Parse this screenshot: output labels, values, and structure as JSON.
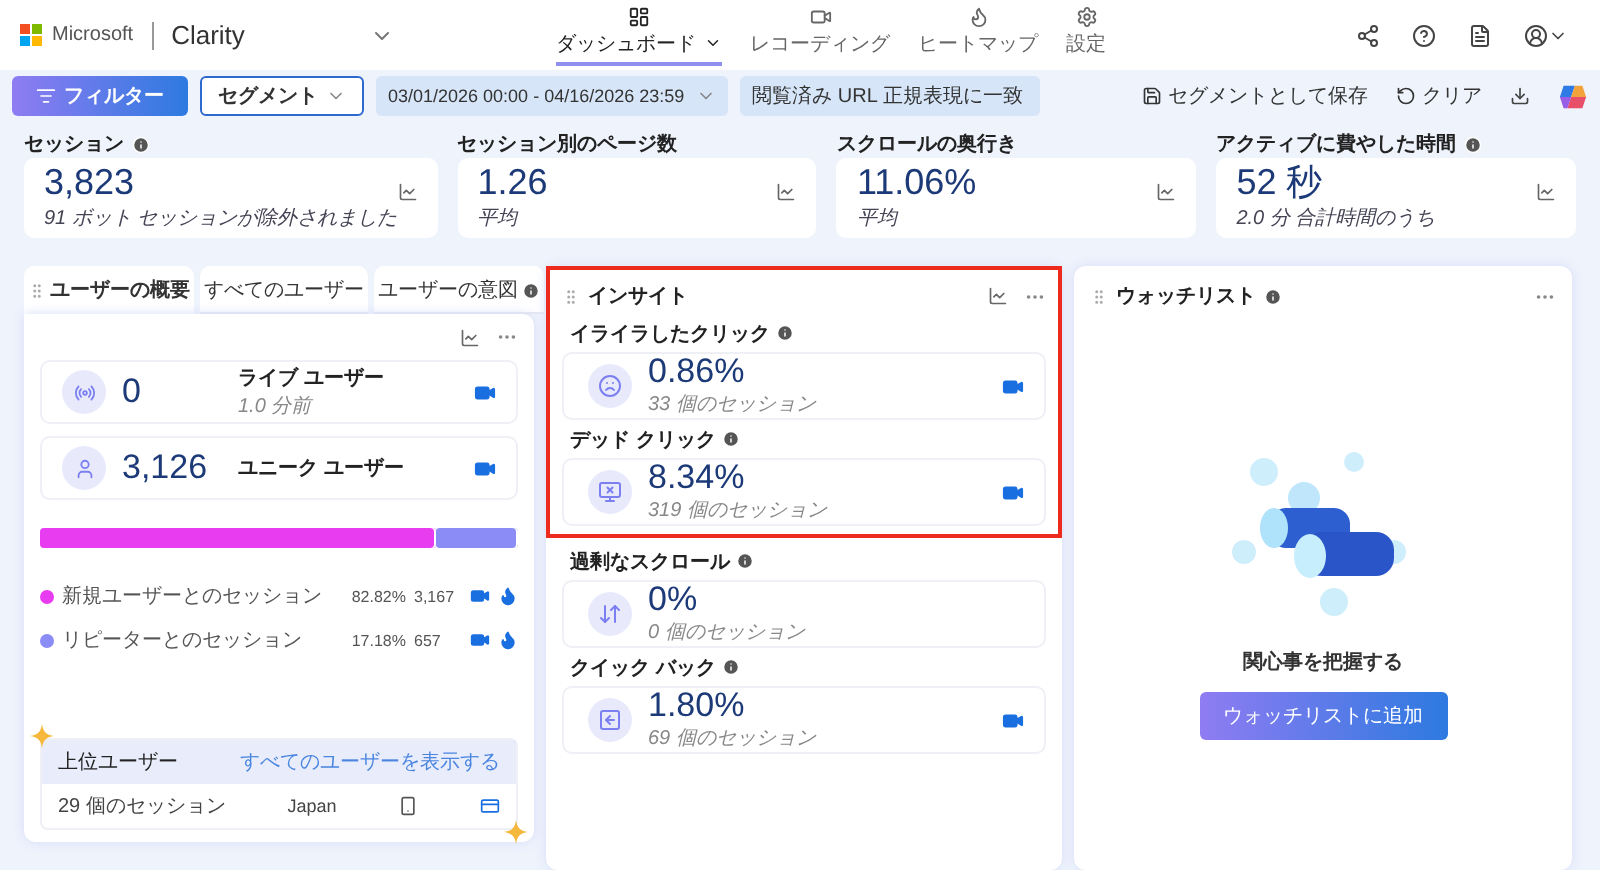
{
  "header": {
    "brand": "Microsoft",
    "product": "Clarity",
    "nav": [
      {
        "label": "ダッシュボード",
        "kind": "dashboard",
        "selected": true
      },
      {
        "label": "レコーディング",
        "kind": "recordings",
        "selected": false
      },
      {
        "label": "ヒートマップ",
        "kind": "heatmaps",
        "selected": false
      },
      {
        "label": "設定",
        "kind": "settings",
        "selected": false
      }
    ]
  },
  "filter_bar": {
    "filter_button": "フィルター",
    "segment": "セグメント",
    "date_range": "03/01/2026 00:00 - 04/16/2026 23:59",
    "url_filter": "閲覧済み URL 正規表現に一致",
    "save": "セグメントとして保存",
    "clear": "クリア"
  },
  "kpis": [
    {
      "label": "セッション",
      "info": true,
      "value": "3,823",
      "note": "91 ボット セッションが除外されました"
    },
    {
      "label": "セッション別のページ数",
      "info": false,
      "value": "1.26",
      "note": "平均"
    },
    {
      "label": "スクロールの奥行き",
      "info": false,
      "value": "11.06%",
      "note": "平均"
    },
    {
      "label": "アクティブに費やした時間",
      "info": true,
      "value": "52 秒",
      "note": "2.0 分 合計時間のうち"
    }
  ],
  "user_panel": {
    "tabs": [
      {
        "label": "ユーザーの概要",
        "selected": true,
        "info": false
      },
      {
        "label": "すべてのユーザー",
        "selected": false,
        "info": false
      },
      {
        "label": "ユーザーの意図",
        "selected": false,
        "info": true
      }
    ],
    "stats": [
      {
        "kind": "live",
        "value": "0",
        "label": "ライブ ユーザー",
        "note": "1.0 分前"
      },
      {
        "kind": "unique",
        "value": "3,126",
        "label": "ユニーク ユーザー"
      }
    ],
    "segments": [
      {
        "label": "新規ユーザーとのセッション",
        "percent": "82.82%",
        "count": "3,167",
        "color": "#e83cf0",
        "level": 0.8282
      },
      {
        "label": "リピーターとのセッション",
        "percent": "17.18%",
        "count": "657",
        "color": "#8b8cf5",
        "level": 0.1718
      }
    ],
    "top_users": {
      "title": "上位ユーザー",
      "link": "すべてのユーザーを表示する",
      "rows": [
        {
          "sessions": "29 個のセッション",
          "country": "Japan"
        }
      ]
    }
  },
  "insights": {
    "title": "インサイト",
    "items": [
      {
        "kind": "rage",
        "label": "イライラしたクリック",
        "value": "0.86%",
        "note": "33 個のセッション",
        "recording": true,
        "highlighted": true
      },
      {
        "kind": "dead",
        "label": "デッド クリック",
        "value": "8.34%",
        "note": "319 個のセッション",
        "recording": true,
        "highlighted": true
      },
      {
        "kind": "scroll",
        "label": "過剰なスクロール",
        "value": "0%",
        "note": "0 個のセッション",
        "recording": false,
        "highlighted": false
      },
      {
        "kind": "quickback",
        "label": "クイック バック",
        "value": "1.80%",
        "note": "69 個のセッション",
        "recording": true,
        "highlighted": false
      }
    ]
  },
  "watchlist": {
    "title": "ウォッチリスト",
    "message": "関心事を把握する",
    "button": "ウォッチリストに追加"
  }
}
